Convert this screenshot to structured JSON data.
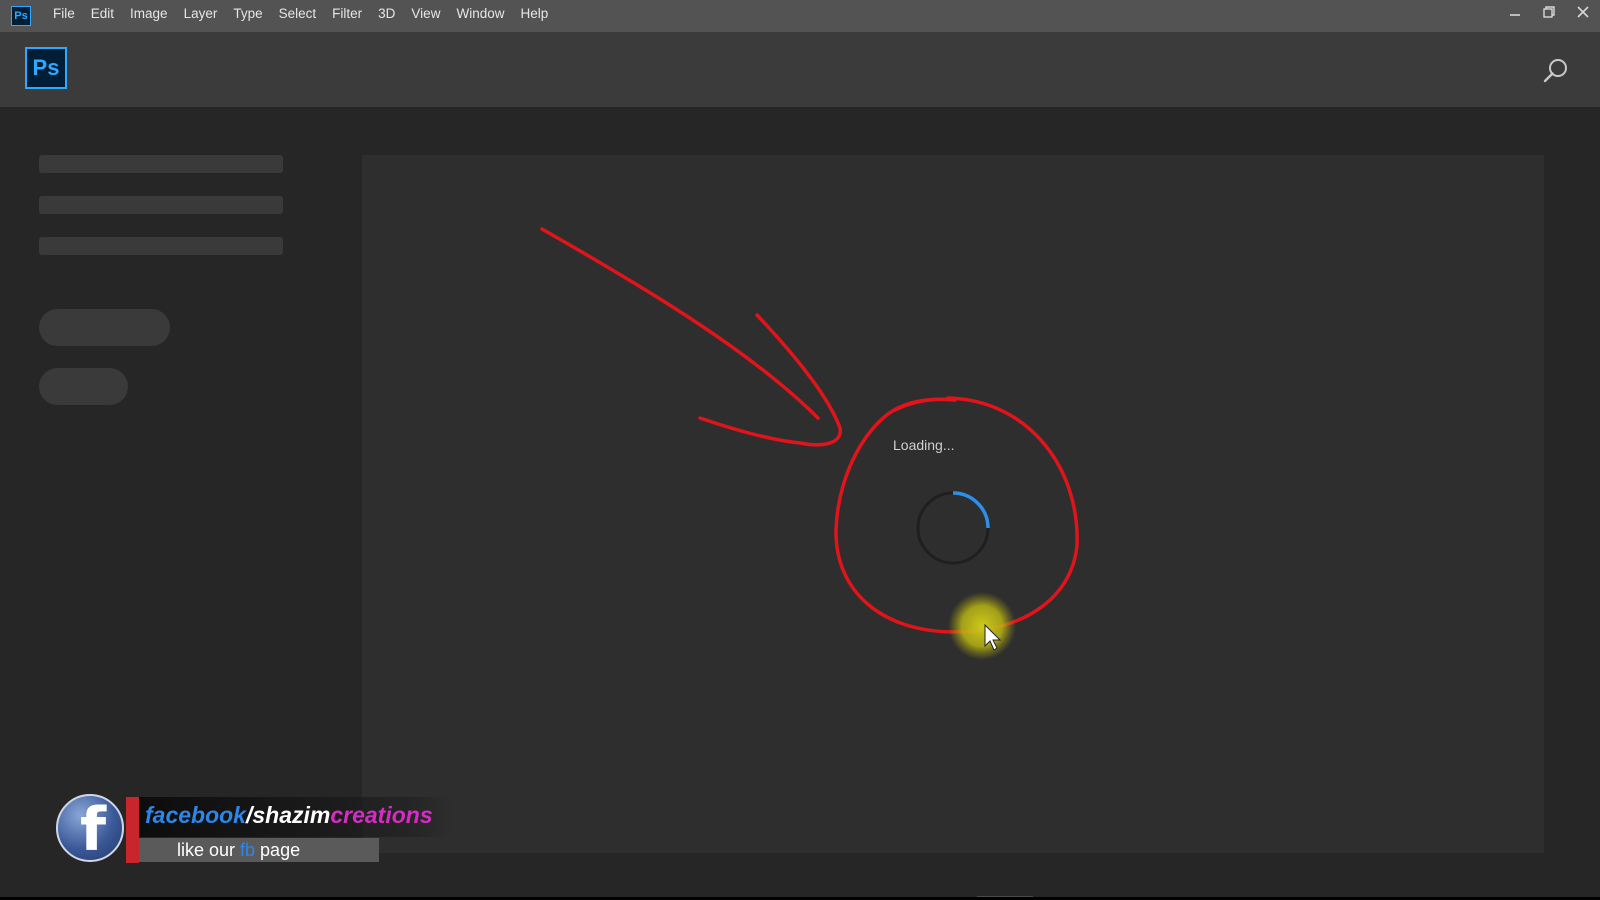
{
  "menubar": {
    "app_icon": "Ps",
    "items": [
      "File",
      "Edit",
      "Image",
      "Layer",
      "Type",
      "Select",
      "Filter",
      "3D",
      "View",
      "Window",
      "Help"
    ],
    "controls": [
      "minimize-icon",
      "restore-icon",
      "close-icon"
    ]
  },
  "header": {
    "logo": "Ps",
    "search_icon": "search-icon"
  },
  "main": {
    "loading_text": "Loading..."
  },
  "overlay": {
    "fb_handle_part1": "facebook",
    "fb_handle_part2": "/shazim",
    "fb_handle_part3": "creations",
    "fb_sub_part1": "like our ",
    "fb_sub_part2": "fb",
    "fb_sub_part3": " page",
    "fb_logo_letter": "f"
  },
  "colors": {
    "menubar_bg": "#535353",
    "brand_blue": "#31a8ff",
    "annotation_red": "#e0141b",
    "spinner_accent": "#2f8fe8",
    "fb_blue": "#2d86e8",
    "fb_magenta": "#d62bc4"
  }
}
